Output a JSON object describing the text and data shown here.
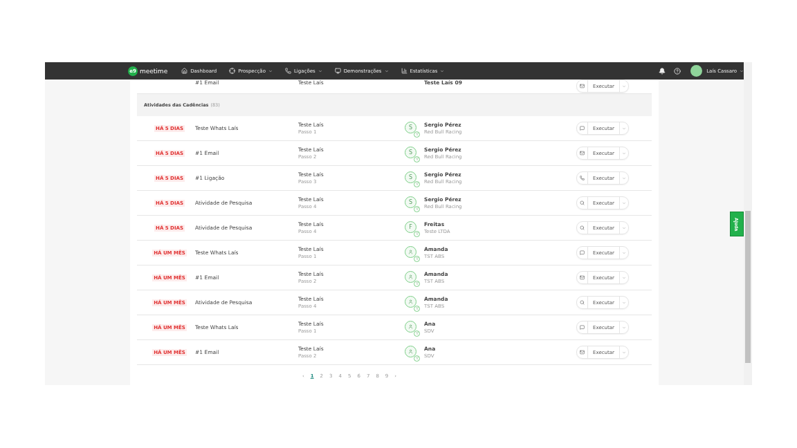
{
  "navbar": {
    "logo_mark": "e9",
    "brand": "meetime",
    "items": [
      {
        "label": "Dashboard",
        "kind": "home",
        "dropdown": false
      },
      {
        "label": "Prospecção",
        "kind": "target",
        "dropdown": true
      },
      {
        "label": "Ligações",
        "kind": "phone",
        "dropdown": true
      },
      {
        "label": "Demonstrações",
        "kind": "monitor",
        "dropdown": true
      },
      {
        "label": "Estatísticas",
        "kind": "chart",
        "dropdown": true
      }
    ],
    "user": {
      "name": "Laís Cassaro"
    }
  },
  "partial_row": {
    "activity": "#1 Email",
    "cadence": "Teste Laís",
    "lead": "Teste Laís 09",
    "kind": "mail",
    "action": "Executar"
  },
  "section": {
    "title": "Atividades das Cadências",
    "count": "(83)"
  },
  "rows": [
    {
      "due": "HÁ 5 DIAS",
      "activity": "Teste Whats Laís",
      "cadence": "Teste Laís",
      "step": "Passo 1",
      "avatar": {
        "kind": "letter",
        "letter": "S"
      },
      "lead": "Sergio Pérez",
      "company": "Red Bull Racing",
      "kind": "chat",
      "action": "Executar"
    },
    {
      "due": "HÁ 5 DIAS",
      "activity": "#1 Email",
      "cadence": "Teste Laís",
      "step": "Passo 2",
      "avatar": {
        "kind": "letter",
        "letter": "S"
      },
      "lead": "Sergio Pérez",
      "company": "Red Bull Racing",
      "kind": "mail",
      "action": "Executar"
    },
    {
      "due": "HÁ 5 DIAS",
      "activity": "#1 Ligação",
      "cadence": "Teste Laís",
      "step": "Passo 3",
      "avatar": {
        "kind": "letter",
        "letter": "S"
      },
      "lead": "Sergio Pérez",
      "company": "Red Bull Racing",
      "kind": "phone",
      "action": "Executar"
    },
    {
      "due": "HÁ 5 DIAS",
      "activity": "Atividade de Pesquisa",
      "cadence": "Teste Laís",
      "step": "Passo 4",
      "avatar": {
        "kind": "letter",
        "letter": "S"
      },
      "lead": "Sergio Pérez",
      "company": "Red Bull Racing",
      "kind": "search",
      "action": "Executar"
    },
    {
      "due": "HÁ 5 DIAS",
      "activity": "Atividade de Pesquisa",
      "cadence": "Teste Laís",
      "step": "Passo 4",
      "avatar": {
        "kind": "letter",
        "letter": "F"
      },
      "lead": "Freitas",
      "company": "Teste LTDA",
      "kind": "search",
      "action": "Executar"
    },
    {
      "due": "HÁ UM MÊS",
      "activity": "Teste Whats Laís",
      "cadence": "Teste Laís",
      "step": "Passo 1",
      "avatar": {
        "kind": "person"
      },
      "lead": "Amanda",
      "company": "TST ABS",
      "kind": "chat",
      "action": "Executar"
    },
    {
      "due": "HÁ UM MÊS",
      "activity": "#1 Email",
      "cadence": "Teste Laís",
      "step": "Passo 2",
      "avatar": {
        "kind": "person"
      },
      "lead": "Amanda",
      "company": "TST ABS",
      "kind": "mail",
      "action": "Executar"
    },
    {
      "due": "HÁ UM MÊS",
      "activity": "Atividade de Pesquisa",
      "cadence": "Teste Laís",
      "step": "Passo 4",
      "avatar": {
        "kind": "person"
      },
      "lead": "Amanda",
      "company": "TST ABS",
      "kind": "search",
      "action": "Executar"
    },
    {
      "due": "HÁ UM MÊS",
      "activity": "Teste Whats Laís",
      "cadence": "Teste Laís",
      "step": "Passo 1",
      "avatar": {
        "kind": "person"
      },
      "lead": "Ana",
      "company": "SDV",
      "kind": "chat",
      "action": "Executar"
    },
    {
      "due": "HÁ UM MÊS",
      "activity": "#1 Email",
      "cadence": "Teste Laís",
      "step": "Passo 2",
      "avatar": {
        "kind": "person"
      },
      "lead": "Ana",
      "company": "SDV",
      "kind": "mail",
      "action": "Executar"
    }
  ],
  "pagination": {
    "prev": "‹",
    "next": "›",
    "pages": [
      {
        "label": "1",
        "selected": true
      },
      {
        "label": "2",
        "selected": false
      },
      {
        "label": "3",
        "selected": false
      },
      {
        "label": "4",
        "selected": false
      },
      {
        "label": "5",
        "selected": false
      },
      {
        "label": "6",
        "selected": false
      },
      {
        "label": "7",
        "selected": false
      },
      {
        "label": "8",
        "selected": false
      },
      {
        "label": "9",
        "selected": false
      }
    ]
  },
  "help_tab": "Ajuda"
}
